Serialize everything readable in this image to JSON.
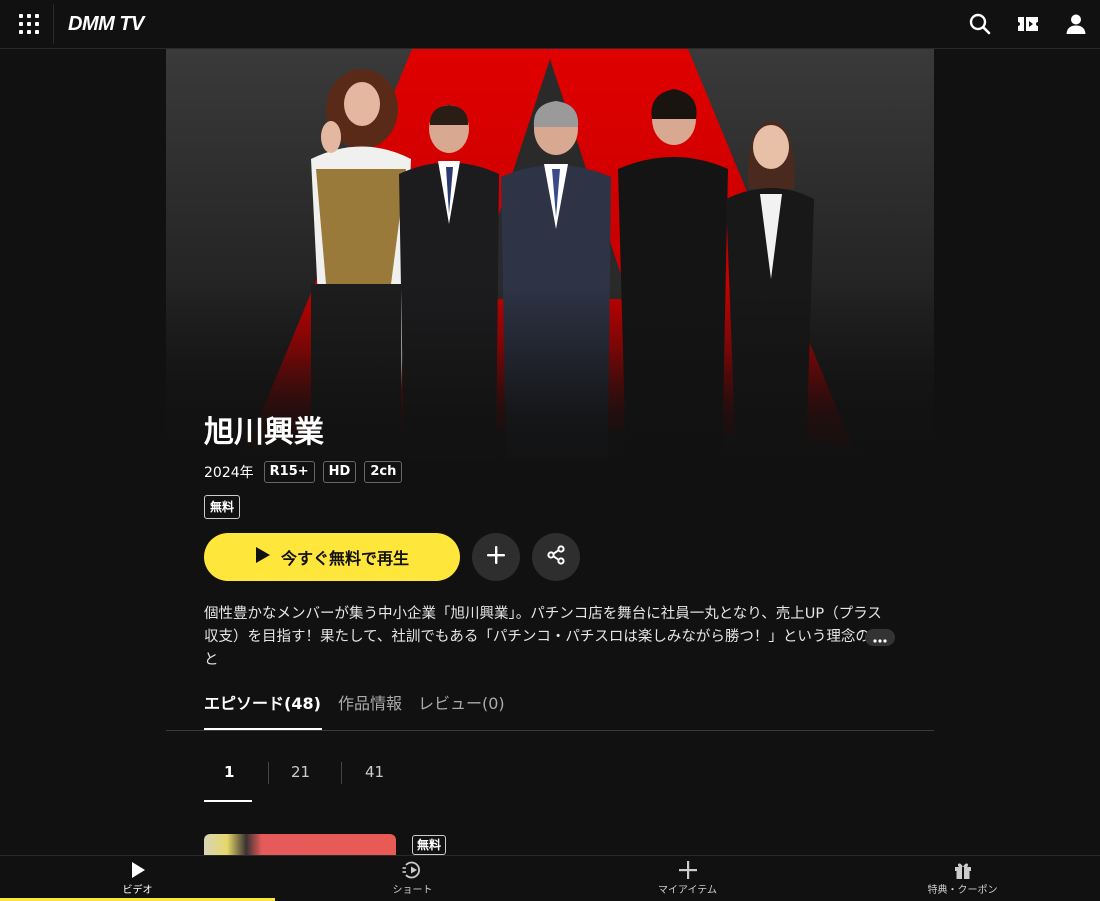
{
  "header": {
    "logo": "DMM TV",
    "icons": [
      "grid-menu-icon",
      "search-icon",
      "ticket-icon",
      "user-icon"
    ]
  },
  "hero": {
    "title": "旭川興業",
    "year": "2024年",
    "badges": [
      "R15+",
      "HD",
      "2ch"
    ],
    "free_badge": "無料"
  },
  "actions": {
    "play_label": "今すぐ無料で再生",
    "icons": [
      "play-icon",
      "plus-icon",
      "share-icon"
    ]
  },
  "description": {
    "text": "個性豊かなメンバーが集う中小企業「旭川興業」。パチンコ店を舞台に社員一丸となり、売上UP（プラス収支）を目指す！果たして、社訓でもある「パチンコ・パチスロは楽しみながら勝つ！」という理念のもと",
    "more_icon": "ellipsis-icon"
  },
  "tabs": [
    {
      "label": "エピソード(48)",
      "active": true
    },
    {
      "label": "作品情報",
      "active": false
    },
    {
      "label": "レビュー(0)",
      "active": false
    }
  ],
  "pager": [
    {
      "label": "1",
      "active": true
    },
    {
      "label": "21",
      "active": false
    },
    {
      "label": "41",
      "active": false
    }
  ],
  "episode": {
    "free_badge": "無料"
  },
  "bottom_nav": [
    {
      "label": "ビデオ",
      "icon": "play-icon",
      "active": true
    },
    {
      "label": "ショート",
      "icon": "short-play-icon",
      "active": false
    },
    {
      "label": "マイアイテム",
      "icon": "plus-icon",
      "active": false
    },
    {
      "label": "特典・クーポン",
      "icon": "gift-icon",
      "active": false
    }
  ],
  "colors": {
    "accent": "#ffe63b",
    "background": "#111111",
    "hero_red": "#e00000"
  }
}
